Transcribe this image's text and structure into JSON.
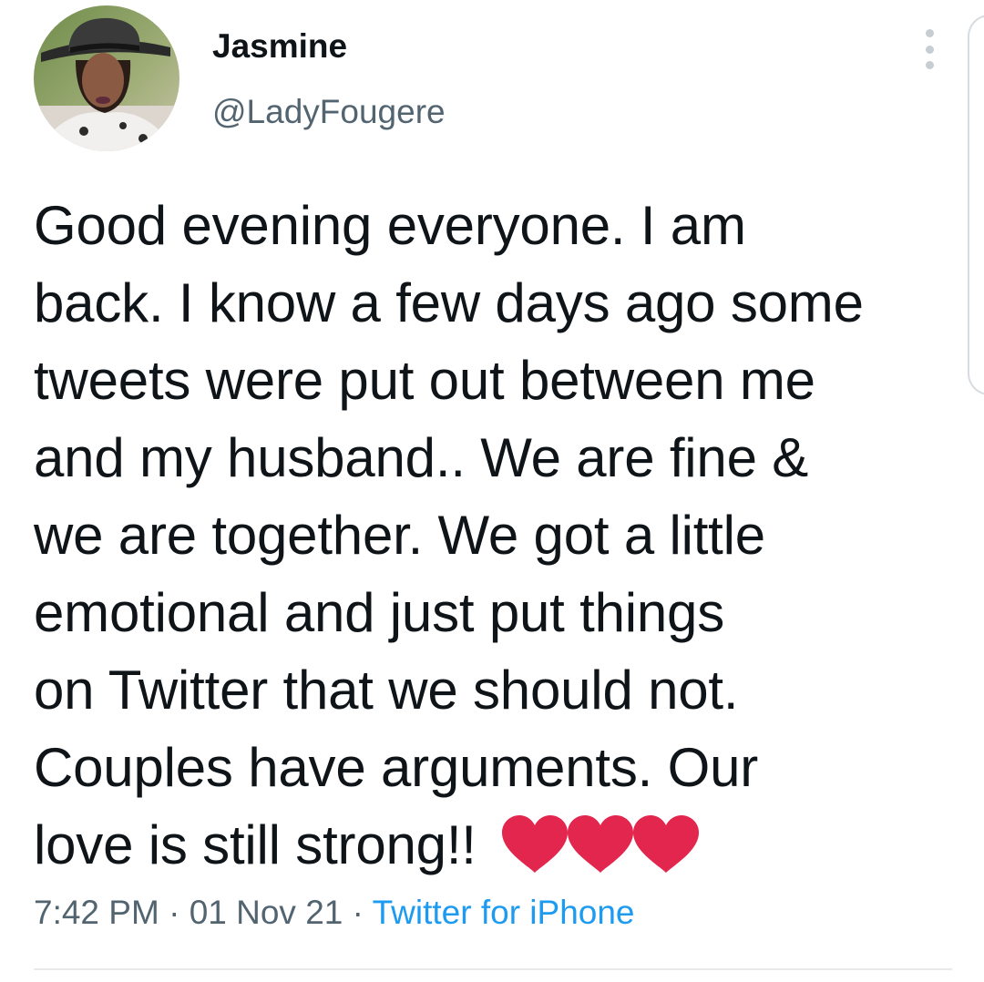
{
  "author": {
    "display_name": "Jasmine",
    "handle": "@LadyFougere"
  },
  "tweet": {
    "lines": [
      "Good evening everyone. I am",
      "back. I know a few days ago some",
      "tweets were put out between me",
      "and my husband.. We are fine &",
      "we are together. We got a little",
      "emotional and just put things",
      "on Twitter that we should not.",
      "Couples have arguments. Our",
      "love is still strong!!"
    ],
    "emoji": [
      "red-heart",
      "red-heart",
      "red-heart"
    ]
  },
  "meta": {
    "time": "7:42 PM",
    "separator": "·",
    "date": "01 Nov 21",
    "source": "Twitter for iPhone"
  },
  "colors": {
    "text": "#0f1419",
    "secondary": "#536471",
    "link": "#1d9bf0",
    "heart": "#e2264d",
    "divider": "#e6e9eb"
  }
}
